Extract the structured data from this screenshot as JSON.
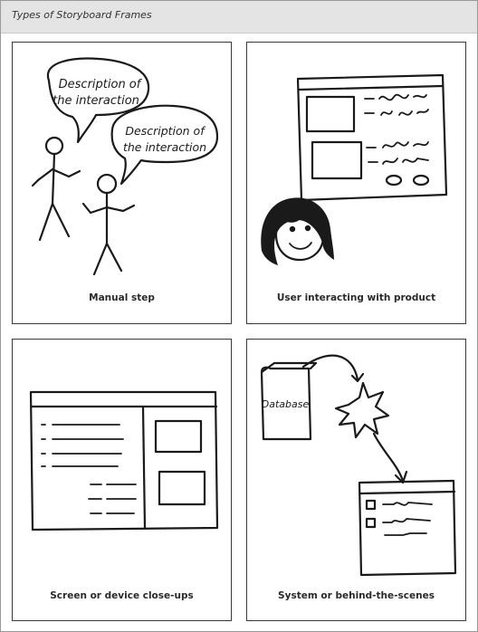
{
  "header": {
    "title": "Types of Storyboard Frames"
  },
  "frames": [
    {
      "caption": "Manual step",
      "bubble_1": "Description of the interaction",
      "bubble_2": "Description of the interaction"
    },
    {
      "caption": "User interacting with product"
    },
    {
      "caption": "Screen or device close-ups"
    },
    {
      "caption": "System or behind-the-scenes",
      "database_label": "Database"
    }
  ]
}
